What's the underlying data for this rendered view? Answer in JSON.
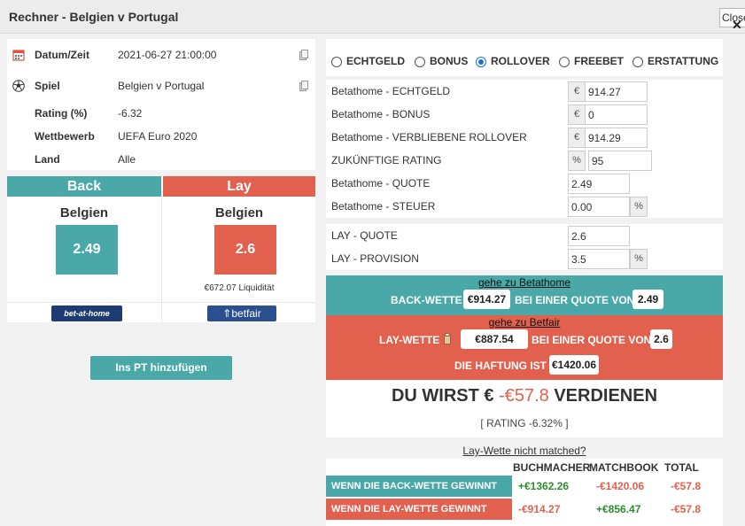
{
  "window": {
    "title": "Rechner - Belgien v Portugal",
    "close_label": "Close"
  },
  "info": {
    "rows": [
      {
        "label": "Datum/Zeit",
        "value": "2021-06-27 21:00:00"
      },
      {
        "label": "Spiel",
        "value": "Belgien v Portugal"
      },
      {
        "label": "Rating (%)",
        "value": "-6.32"
      },
      {
        "label": "Wettbewerb",
        "value": "UEFA Euro 2020"
      },
      {
        "label": "Land",
        "value": "Alle"
      }
    ]
  },
  "back": {
    "header": "Back",
    "team": "Belgien",
    "odds": "2.49",
    "bookmaker_logo": "bet-at-home",
    "color": "#4aa8a8"
  },
  "lay": {
    "header": "Lay",
    "team": "Belgien",
    "odds": "2.6",
    "liquidity": "€672.07 Liquidität",
    "exchange_logo": "betfair",
    "color": "#e2614e"
  },
  "add_pt_label": "Ins PT hinzufügen",
  "bet_types": [
    {
      "label": "ECHTGELD",
      "selected": false
    },
    {
      "label": "BONUS",
      "selected": false
    },
    {
      "label": "ROLLOVER",
      "selected": true
    },
    {
      "label": "FREEBET",
      "selected": false
    },
    {
      "label": "ERSTATTUNG",
      "selected": false
    }
  ],
  "form": {
    "echtgeld": {
      "label": "Betathome - ECHTGELD",
      "prefix": "€",
      "value": "914.27"
    },
    "bonus": {
      "label": "Betathome - BONUS",
      "prefix": "€",
      "value": "0"
    },
    "rollover": {
      "label": "Betathome - VERBLIEBENE ROLLOVER",
      "prefix": "€",
      "value": "914.29"
    },
    "rating": {
      "label": "ZUKÜNFTIGE RATING",
      "prefix": "%",
      "value": "95"
    },
    "quote": {
      "label": "Betathome - QUOTE",
      "value": "2.49"
    },
    "steuer": {
      "label": "Betathome - STEUER",
      "value": "0.00",
      "suffix": "%"
    },
    "lay_quote": {
      "label": "LAY - QUOTE",
      "value": "2.6"
    },
    "lay_provision": {
      "label": "LAY - PROVISION",
      "value": "3.5",
      "suffix": "%"
    }
  },
  "back_bet": {
    "link": "gehe zu Betathome",
    "label": "BACK-WETTE",
    "stake": "€914.27",
    "mid": "BEI EINER QUOTE VON",
    "odds": "2.49"
  },
  "lay_bet": {
    "link": "gehe zu Betfair",
    "label": "LAY-WETTE",
    "stake": "€887.54",
    "mid": "BEI EINER QUOTE VON",
    "odds": "2.6",
    "liability_label": "DIE HAFTUNG IST",
    "liability": "€1420.06"
  },
  "result": {
    "prefix": "DU WIRST €",
    "amount": "-€57.8",
    "suffix": "VERDIENEN",
    "rating": "[ RATING -6.32% ]"
  },
  "not_matched_link": "Lay-Wette nicht matched?",
  "table": {
    "headers": [
      "BUCHMACHER",
      "MATCHBOOK",
      "TOTAL"
    ],
    "rows": [
      {
        "label": "WENN DIE BACK-WETTE GEWINNT",
        "buchmacher": "+€1362.26",
        "matchbook": "-€1420.06",
        "total": "-€57.8"
      },
      {
        "label": "WENN DIE LAY-WETTE GEWINNT",
        "buchmacher": "-€914.27",
        "matchbook": "+€856.47",
        "total": "-€57.8"
      }
    ]
  }
}
